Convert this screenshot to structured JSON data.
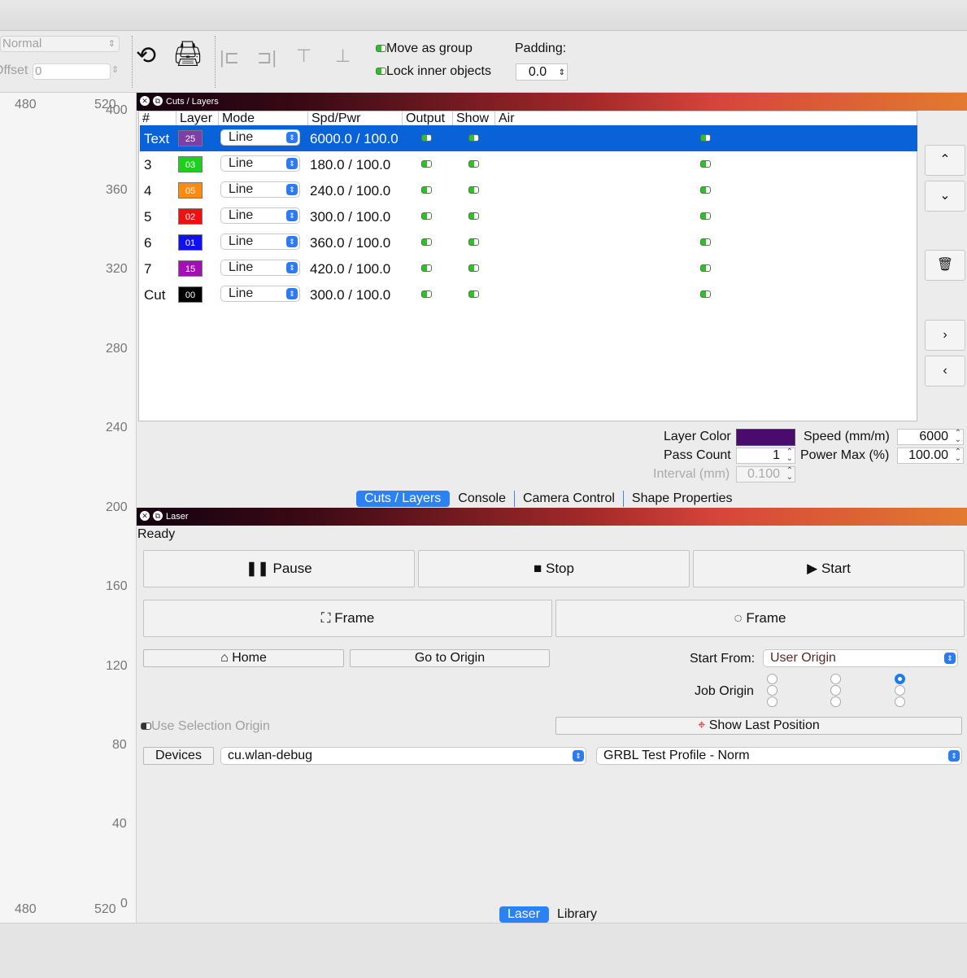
{
  "toolbar": {
    "blend_mode": "Normal",
    "offset_label": "Offset",
    "offset_value": "0",
    "move_as_group": "Move as group",
    "lock_inner_objects": "Lock inner objects",
    "padding_label": "Padding:",
    "padding_value": "0.0"
  },
  "ruler": {
    "top_labels": [
      "480",
      "520"
    ],
    "bottom_labels": [
      "480",
      "520"
    ],
    "v_labels": [
      "400",
      "360",
      "320",
      "280",
      "240",
      "200",
      "160",
      "120",
      "80",
      "40",
      "0"
    ]
  },
  "cuts": {
    "title": "Cuts / Layers",
    "headers": {
      "num": "#",
      "layer": "Layer",
      "mode": "Mode",
      "spdpwr": "Spd/Pwr",
      "output": "Output",
      "show": "Show",
      "air": "Air"
    },
    "rows": [
      {
        "num": "Text",
        "layer": "25",
        "color": "#7b3fa6",
        "mode": "Line",
        "spdpwr": "6000.0 / 100.0"
      },
      {
        "num": "3",
        "layer": "03",
        "color": "#1fcf1f",
        "mode": "Line",
        "spdpwr": "180.0 / 100.0"
      },
      {
        "num": "4",
        "layer": "05",
        "color": "#ff8a10",
        "mode": "Line",
        "spdpwr": "240.0 / 100.0"
      },
      {
        "num": "5",
        "layer": "02",
        "color": "#ee1111",
        "mode": "Line",
        "spdpwr": "300.0 / 100.0"
      },
      {
        "num": "6",
        "layer": "01",
        "color": "#1111ee",
        "mode": "Line",
        "spdpwr": "360.0 / 100.0"
      },
      {
        "num": "7",
        "layer": "15",
        "color": "#a012b0",
        "mode": "Line",
        "spdpwr": "420.0 / 100.0"
      },
      {
        "num": "Cut",
        "layer": "00",
        "color": "#000000",
        "mode": "Line",
        "spdpwr": "300.0 / 100.0"
      }
    ],
    "layer_color_label": "Layer Color",
    "layer_color": "#4a0a6e",
    "speed_label": "Speed (mm/m)",
    "speed_value": "6000",
    "pass_count_label": "Pass Count",
    "pass_count_value": "1",
    "power_max_label": "Power Max (%)",
    "power_max_value": "100.00",
    "interval_label": "Interval (mm)",
    "interval_value": "0.100",
    "tabs": [
      "Cuts / Layers",
      "Console",
      "Camera Control",
      "Shape Properties"
    ]
  },
  "laser": {
    "title": "Laser",
    "status": "Ready",
    "pause": "Pause",
    "stop": "Stop",
    "start": "Start",
    "frame_rect": "Frame",
    "frame_circle": "Frame",
    "home": "Home",
    "go_to_origin": "Go to Origin",
    "start_from_label": "Start From:",
    "start_from_value": "User Origin",
    "job_origin_label": "Job Origin",
    "use_selection_origin": "Use Selection Origin",
    "show_last_position": "Show Last Position",
    "devices": "Devices",
    "device_port": "cu.wlan-debug",
    "device_profile": "GRBL Test Profile - Norm",
    "tabs": [
      "Laser",
      "Library"
    ]
  },
  "colors": {
    "accent": "#2a82f5",
    "selection": "#0a62d9",
    "led_on": "#2fbf2a"
  }
}
